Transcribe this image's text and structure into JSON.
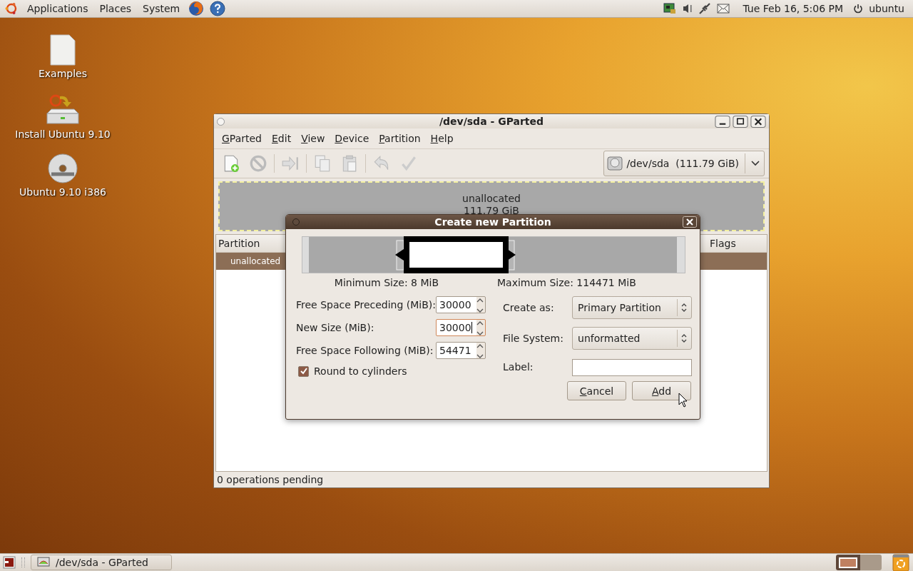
{
  "top_panel": {
    "menus": [
      "Applications",
      "Places",
      "System"
    ],
    "clock": "Tue Feb 16,  5:06 PM",
    "user": "ubuntu"
  },
  "desktop_icons": [
    {
      "label": "Examples",
      "kind": "file"
    },
    {
      "label": "Install Ubuntu 9.10",
      "kind": "installer"
    },
    {
      "label": "Ubuntu 9.10 i386",
      "kind": "cd"
    }
  ],
  "gparted": {
    "title": "/dev/sda - GParted",
    "menu": [
      "GParted",
      "Edit",
      "View",
      "Device",
      "Partition",
      "Help"
    ],
    "device": "/dev/sda  (111.79 GiB)",
    "disk_map": {
      "label": "unallocated",
      "size": "111.79 GiB"
    },
    "table": {
      "columns": [
        "Partition",
        "Flags"
      ],
      "rows": [
        {
          "partition": "unallocated",
          "selected": true
        }
      ]
    },
    "status_bar": "0 operations pending"
  },
  "dialog": {
    "title": "Create new Partition",
    "min_size": "Minimum Size: 8 MiB",
    "max_size": "Maximum Size: 114471 MiB",
    "spin_fields": [
      {
        "label": "Free Space Preceding (MiB):",
        "value": "30000",
        "focused": false
      },
      {
        "label": "New Size (MiB):",
        "value": "30000",
        "focused": true
      },
      {
        "label": "Free Space Following (MiB):",
        "value": "54471",
        "focused": false
      }
    ],
    "round_to_cylinders": {
      "label": "Round to cylinders",
      "checked": true
    },
    "create_as": {
      "label": "Create as:",
      "value": "Primary Partition"
    },
    "file_system": {
      "label": "File System:",
      "value": "unformatted"
    },
    "label_field": {
      "label": "Label:"
    },
    "buttons": [
      "Cancel",
      "Add"
    ]
  },
  "taskbar": {
    "window": "/dev/sda - GParted"
  }
}
